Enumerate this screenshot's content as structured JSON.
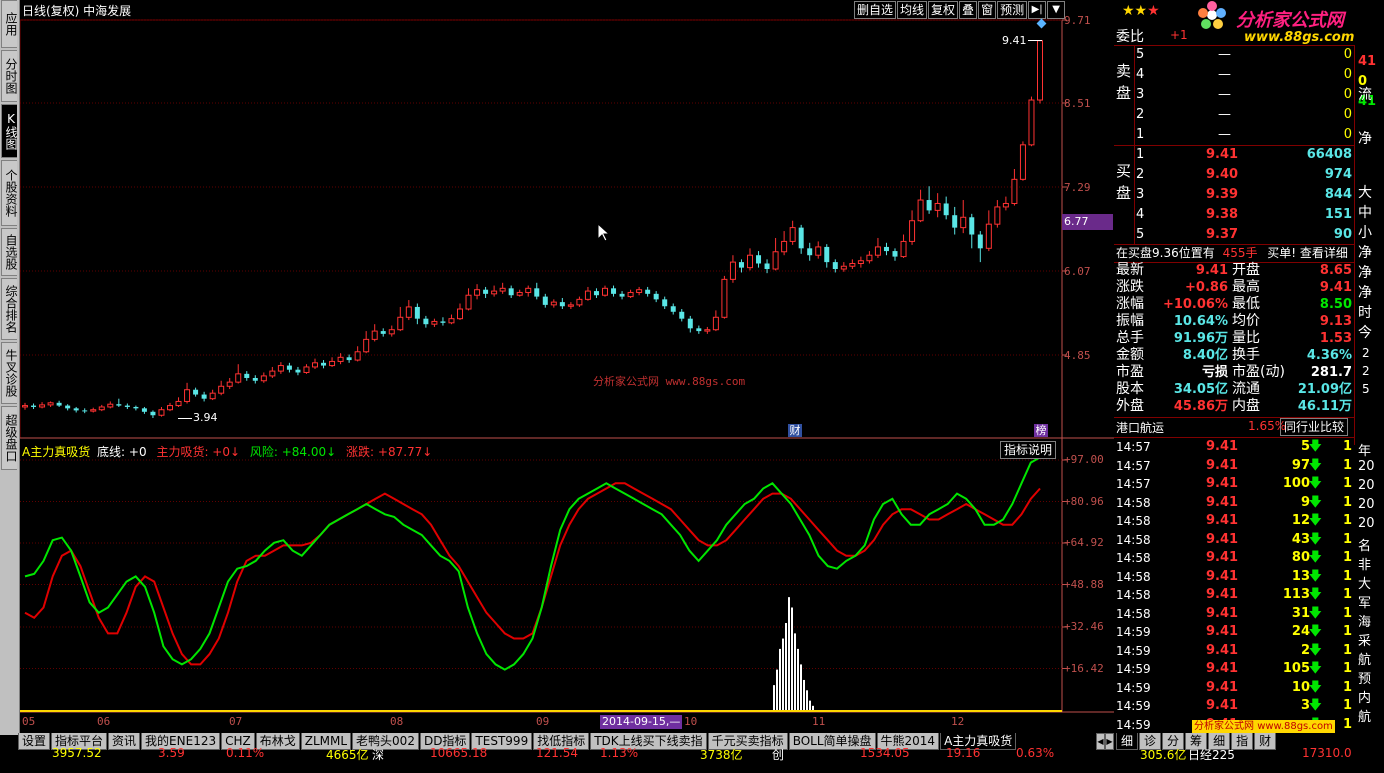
{
  "window": {
    "title": "日线(复权) 中海发展",
    "brand_site": "分析家公式网",
    "brand_url": "www.88gs.com",
    "rating_stars": 3,
    "watermark": "分析家公式网 www.88gs.com"
  },
  "left_tabs": [
    "应用",
    "分时图",
    "K线图",
    "个股资料",
    "自选股",
    "综合排名",
    "牛叉诊股",
    "超级盘口"
  ],
  "left_tab_active": 2,
  "toolbar": [
    "删自选",
    "均线",
    "复权",
    "叠",
    "窗",
    "预测"
  ],
  "price_axis": [
    "9.71",
    "8.51",
    "7.29",
    "6.07",
    "4.85"
  ],
  "price_axis_marker": "6.77",
  "price_labels": {
    "high": "9.41",
    "low": "3.94"
  },
  "markers": {
    "cai": "财",
    "bang": "榜"
  },
  "indicator": {
    "name": "A主力真吸货",
    "line_base": "底线: +0",
    "line_main": "主力吸货: +0↓",
    "line_risk": "风险: +84.00↓",
    "line_rise": "涨跌: +87.77↓",
    "help_button": "指标说明",
    "axis": [
      "+97.00",
      "+80.96",
      "+64.92",
      "+48.88",
      "+32.46",
      "+16.42"
    ]
  },
  "x_axis": {
    "months": [
      "05",
      "06",
      "07",
      "08",
      "09",
      "10",
      "11",
      "12"
    ],
    "cursor_date": "2014-09-15,—"
  },
  "bottom_tabs": [
    "设置",
    "指标平台",
    "资讯",
    "我的ENE123",
    "CHZ",
    "布林戈",
    "ZLMML",
    "老鸭头002",
    "DD指标",
    "TEST999",
    "找低指标",
    "TDK上线买下线卖指",
    "千元买卖指标",
    "BOLL简单操盘",
    "牛熊2014",
    "A主力真吸货"
  ],
  "bottom_tab_active": 15,
  "right_bottom_tabs": [
    "细",
    "诊",
    "分",
    "筹",
    "细",
    "指",
    "财"
  ],
  "order_book": {
    "weibi_label": "委比",
    "weibi_value": "+1",
    "sell_label": "卖盘",
    "buy_label": "买盘",
    "sell": [
      {
        "level": "5",
        "price": "—",
        "vol": "0"
      },
      {
        "level": "4",
        "price": "—",
        "vol": "0"
      },
      {
        "level": "3",
        "price": "—",
        "vol": "0"
      },
      {
        "level": "2",
        "price": "—",
        "vol": "0"
      },
      {
        "level": "1",
        "price": "—",
        "vol": "0"
      }
    ],
    "buy": [
      {
        "level": "1",
        "price": "9.41",
        "vol": "66408"
      },
      {
        "level": "2",
        "price": "9.40",
        "vol": "974"
      },
      {
        "level": "3",
        "price": "9.39",
        "vol": "844"
      },
      {
        "level": "4",
        "price": "9.38",
        "vol": "151"
      },
      {
        "level": "5",
        "price": "9.37",
        "vol": "90"
      }
    ],
    "side_col": [
      "41",
      "0",
      "41"
    ],
    "side_labels": [
      "流",
      "净"
    ],
    "notice": "在买盘9.36位置有",
    "notice_vol": "455手",
    "notice_link": "买单! 查看详细"
  },
  "quote": {
    "rows": [
      {
        "l1": "最新",
        "v1": "9.41",
        "l2": "开盘",
        "v2": "8.65"
      },
      {
        "l1": "涨跌",
        "v1": "+0.86",
        "l2": "最高",
        "v2": "9.41"
      },
      {
        "l1": "涨幅",
        "v1": "+10.06%",
        "l2": "最低",
        "v2": "8.50"
      },
      {
        "l1": "振幅",
        "v1": "10.64%",
        "l2": "均价",
        "v2": "9.13"
      },
      {
        "l1": "总手",
        "v1": "91.96万",
        "l2": "量比",
        "v2": "1.53"
      },
      {
        "l1": "金额",
        "v1": "8.40亿",
        "l2": "换手",
        "v2": "4.36%"
      },
      {
        "l1": "市盈",
        "v1": "亏损",
        "l2": "市盈(动)",
        "v2": "281.7"
      },
      {
        "l1": "股本",
        "v1": "34.05亿",
        "l2": "流通",
        "v2": "21.09亿"
      },
      {
        "l1": "外盘",
        "v1": "45.86万",
        "l2": "内盘",
        "v2": "46.11万"
      }
    ],
    "side_labels": [
      "大",
      "中",
      "小",
      "净",
      "净",
      "净",
      "时",
      "今"
    ],
    "side_numbers": [
      "2",
      "2",
      "5"
    ],
    "industry": "港口航运",
    "industry_pct": "1.65%",
    "compare_button": "同行业比较"
  },
  "ticks": [
    {
      "t": "14:57",
      "p": "9.41",
      "v": "5"
    },
    {
      "t": "14:57",
      "p": "9.41",
      "v": "97"
    },
    {
      "t": "14:57",
      "p": "9.41",
      "v": "100"
    },
    {
      "t": "14:58",
      "p": "9.41",
      "v": "9"
    },
    {
      "t": "14:58",
      "p": "9.41",
      "v": "12"
    },
    {
      "t": "14:58",
      "p": "9.41",
      "v": "43"
    },
    {
      "t": "14:58",
      "p": "9.41",
      "v": "80"
    },
    {
      "t": "14:58",
      "p": "9.41",
      "v": "13"
    },
    {
      "t": "14:58",
      "p": "9.41",
      "v": "113"
    },
    {
      "t": "14:58",
      "p": "9.41",
      "v": "31"
    },
    {
      "t": "14:59",
      "p": "9.41",
      "v": "24"
    },
    {
      "t": "14:59",
      "p": "9.41",
      "v": "2"
    },
    {
      "t": "14:59",
      "p": "9.41",
      "v": "105"
    },
    {
      "t": "14:59",
      "p": "9.41",
      "v": "10"
    },
    {
      "t": "14:59",
      "p": "9.41",
      "v": "3"
    },
    {
      "t": "14:59",
      "p": "9.41",
      "v": "—"
    }
  ],
  "tick_side": [
    "年",
    "20",
    "20",
    "20",
    "20",
    "名",
    "非",
    "大",
    "军",
    "海",
    "采",
    "航",
    "预",
    "内",
    "航"
  ],
  "status_bar": [
    "3957.52",
    "3.59",
    "0.11%",
    "4665亿",
    "深",
    "10665.18",
    "121.54",
    "1.13%",
    "3738亿",
    "创",
    "1534.05",
    "19.16",
    "0.63%",
    "305.6亿",
    "日经225",
    "17310.0"
  ],
  "colors": {
    "up": "#ff3232",
    "down": "#5ae6e6",
    "green": "#00e600",
    "axis": "#c0504d",
    "grid": "#800000"
  },
  "chart_data": {
    "type": "candlestick_with_indicator",
    "price_range": [
      3.94,
      9.71
    ],
    "candles": [
      {
        "o": 4.1,
        "c": 4.12,
        "h": 4.16,
        "l": 4.06
      },
      {
        "o": 4.12,
        "c": 4.1,
        "h": 4.15,
        "l": 4.07
      },
      {
        "o": 4.1,
        "c": 4.13,
        "h": 4.17,
        "l": 4.08
      },
      {
        "o": 4.13,
        "c": 4.16,
        "h": 4.18,
        "l": 4.1
      },
      {
        "o": 4.16,
        "c": 4.12,
        "h": 4.19,
        "l": 4.1
      },
      {
        "o": 4.12,
        "c": 4.08,
        "h": 4.14,
        "l": 4.05
      },
      {
        "o": 4.08,
        "c": 4.05,
        "h": 4.1,
        "l": 4.02
      },
      {
        "o": 4.05,
        "c": 4.04,
        "h": 4.08,
        "l": 4.01
      },
      {
        "o": 4.04,
        "c": 4.06,
        "h": 4.09,
        "l": 4.02
      },
      {
        "o": 4.06,
        "c": 4.1,
        "h": 4.13,
        "l": 4.04
      },
      {
        "o": 4.1,
        "c": 4.14,
        "h": 4.18,
        "l": 4.08
      },
      {
        "o": 4.14,
        "c": 4.12,
        "h": 4.22,
        "l": 4.1
      },
      {
        "o": 4.12,
        "c": 4.1,
        "h": 4.15,
        "l": 4.07
      },
      {
        "o": 4.1,
        "c": 4.08,
        "h": 4.12,
        "l": 4.05
      },
      {
        "o": 4.08,
        "c": 4.03,
        "h": 4.1,
        "l": 4.0
      },
      {
        "o": 4.03,
        "c": 3.98,
        "h": 4.05,
        "l": 3.94
      },
      {
        "o": 3.98,
        "c": 4.06,
        "h": 4.1,
        "l": 3.96
      },
      {
        "o": 4.06,
        "c": 4.12,
        "h": 4.16,
        "l": 4.04
      },
      {
        "o": 4.12,
        "c": 4.18,
        "h": 4.24,
        "l": 4.1
      },
      {
        "o": 4.18,
        "c": 4.35,
        "h": 4.45,
        "l": 4.15
      },
      {
        "o": 4.35,
        "c": 4.28,
        "h": 4.38,
        "l": 4.25
      },
      {
        "o": 4.28,
        "c": 4.22,
        "h": 4.32,
        "l": 4.18
      },
      {
        "o": 4.22,
        "c": 4.3,
        "h": 4.35,
        "l": 4.2
      },
      {
        "o": 4.3,
        "c": 4.4,
        "h": 4.48,
        "l": 4.27
      },
      {
        "o": 4.4,
        "c": 4.46,
        "h": 4.52,
        "l": 4.36
      },
      {
        "o": 4.46,
        "c": 4.58,
        "h": 4.72,
        "l": 4.44
      },
      {
        "o": 4.58,
        "c": 4.52,
        "h": 4.62,
        "l": 4.48
      },
      {
        "o": 4.52,
        "c": 4.48,
        "h": 4.56,
        "l": 4.44
      },
      {
        "o": 4.48,
        "c": 4.55,
        "h": 4.6,
        "l": 4.45
      },
      {
        "o": 4.55,
        "c": 4.62,
        "h": 4.68,
        "l": 4.52
      },
      {
        "o": 4.62,
        "c": 4.7,
        "h": 4.75,
        "l": 4.58
      },
      {
        "o": 4.7,
        "c": 4.64,
        "h": 4.74,
        "l": 4.6
      },
      {
        "o": 4.64,
        "c": 4.6,
        "h": 4.68,
        "l": 4.56
      },
      {
        "o": 4.6,
        "c": 4.68,
        "h": 4.72,
        "l": 4.58
      },
      {
        "o": 4.68,
        "c": 4.74,
        "h": 4.8,
        "l": 4.65
      },
      {
        "o": 4.74,
        "c": 4.7,
        "h": 4.78,
        "l": 4.66
      },
      {
        "o": 4.7,
        "c": 4.76,
        "h": 4.82,
        "l": 4.68
      },
      {
        "o": 4.76,
        "c": 4.82,
        "h": 4.88,
        "l": 4.72
      },
      {
        "o": 4.82,
        "c": 4.78,
        "h": 4.86,
        "l": 4.74
      },
      {
        "o": 4.78,
        "c": 4.9,
        "h": 4.98,
        "l": 4.76
      },
      {
        "o": 4.9,
        "c": 5.08,
        "h": 5.2,
        "l": 4.88
      },
      {
        "o": 5.08,
        "c": 5.2,
        "h": 5.3,
        "l": 5.05
      },
      {
        "o": 5.2,
        "c": 5.16,
        "h": 5.24,
        "l": 5.12
      },
      {
        "o": 5.16,
        "c": 5.22,
        "h": 5.28,
        "l": 5.12
      },
      {
        "o": 5.22,
        "c": 5.4,
        "h": 5.55,
        "l": 5.2
      },
      {
        "o": 5.4,
        "c": 5.55,
        "h": 5.65,
        "l": 5.36
      },
      {
        "o": 5.55,
        "c": 5.38,
        "h": 5.6,
        "l": 5.3
      },
      {
        "o": 5.38,
        "c": 5.3,
        "h": 5.42,
        "l": 5.25
      },
      {
        "o": 5.3,
        "c": 5.34,
        "h": 5.38,
        "l": 5.26
      },
      {
        "o": 5.34,
        "c": 5.32,
        "h": 5.4,
        "l": 5.28
      },
      {
        "o": 5.32,
        "c": 5.38,
        "h": 5.44,
        "l": 5.3
      },
      {
        "o": 5.38,
        "c": 5.52,
        "h": 5.6,
        "l": 5.36
      },
      {
        "o": 5.52,
        "c": 5.72,
        "h": 5.82,
        "l": 5.5
      },
      {
        "o": 5.72,
        "c": 5.8,
        "h": 5.88,
        "l": 5.66
      },
      {
        "o": 5.8,
        "c": 5.74,
        "h": 5.84,
        "l": 5.68
      },
      {
        "o": 5.74,
        "c": 5.78,
        "h": 5.86,
        "l": 5.7
      },
      {
        "o": 5.78,
        "c": 5.82,
        "h": 5.9,
        "l": 5.74
      },
      {
        "o": 5.82,
        "c": 5.72,
        "h": 5.86,
        "l": 5.68
      },
      {
        "o": 5.72,
        "c": 5.76,
        "h": 5.8,
        "l": 5.7
      },
      {
        "o": 5.76,
        "c": 5.82,
        "h": 5.86,
        "l": 5.7
      },
      {
        "o": 5.82,
        "c": 5.7,
        "h": 5.9,
        "l": 5.66
      },
      {
        "o": 5.7,
        "c": 5.58,
        "h": 5.74,
        "l": 5.54
      },
      {
        "o": 5.58,
        "c": 5.62,
        "h": 5.66,
        "l": 5.54
      },
      {
        "o": 5.62,
        "c": 5.56,
        "h": 5.68,
        "l": 5.52
      },
      {
        "o": 5.56,
        "c": 5.58,
        "h": 5.62,
        "l": 5.52
      },
      {
        "o": 5.58,
        "c": 5.66,
        "h": 5.7,
        "l": 5.55
      },
      {
        "o": 5.66,
        "c": 5.78,
        "h": 5.84,
        "l": 5.64
      },
      {
        "o": 5.78,
        "c": 5.72,
        "h": 5.82,
        "l": 5.68
      },
      {
        "o": 5.72,
        "c": 5.82,
        "h": 5.86,
        "l": 5.7
      },
      {
        "o": 5.82,
        "c": 5.74,
        "h": 5.86,
        "l": 5.7
      },
      {
        "o": 5.74,
        "c": 5.7,
        "h": 5.78,
        "l": 5.66
      },
      {
        "o": 5.7,
        "c": 5.76,
        "h": 5.8,
        "l": 5.68
      },
      {
        "o": 5.76,
        "c": 5.8,
        "h": 5.84,
        "l": 5.72
      },
      {
        "o": 5.8,
        "c": 5.74,
        "h": 5.84,
        "l": 5.7
      },
      {
        "o": 5.74,
        "c": 5.66,
        "h": 5.78,
        "l": 5.62
      },
      {
        "o": 5.66,
        "c": 5.56,
        "h": 5.7,
        "l": 5.52
      },
      {
        "o": 5.56,
        "c": 5.48,
        "h": 5.6,
        "l": 5.44
      },
      {
        "o": 5.48,
        "c": 5.38,
        "h": 5.52,
        "l": 5.34
      },
      {
        "o": 5.38,
        "c": 5.24,
        "h": 5.42,
        "l": 5.18
      },
      {
        "o": 5.24,
        "c": 5.2,
        "h": 5.28,
        "l": 5.16
      },
      {
        "o": 5.2,
        "c": 5.22,
        "h": 5.26,
        "l": 5.16
      },
      {
        "o": 5.22,
        "c": 5.4,
        "h": 5.5,
        "l": 5.2
      },
      {
        "o": 5.4,
        "c": 5.95,
        "h": 6.0,
        "l": 5.38
      },
      {
        "o": 5.95,
        "c": 6.2,
        "h": 6.3,
        "l": 5.9
      },
      {
        "o": 6.2,
        "c": 6.12,
        "h": 6.24,
        "l": 6.05
      },
      {
        "o": 6.12,
        "c": 6.3,
        "h": 6.4,
        "l": 6.08
      },
      {
        "o": 6.3,
        "c": 6.18,
        "h": 6.36,
        "l": 6.12
      },
      {
        "o": 6.18,
        "c": 6.1,
        "h": 6.24,
        "l": 6.04
      },
      {
        "o": 6.1,
        "c": 6.35,
        "h": 6.55,
        "l": 6.08
      },
      {
        "o": 6.35,
        "c": 6.5,
        "h": 6.65,
        "l": 6.3
      },
      {
        "o": 6.5,
        "c": 6.7,
        "h": 6.8,
        "l": 6.45
      },
      {
        "o": 6.7,
        "c": 6.4,
        "h": 6.74,
        "l": 6.32
      },
      {
        "o": 6.4,
        "c": 6.3,
        "h": 6.48,
        "l": 6.22
      },
      {
        "o": 6.3,
        "c": 6.42,
        "h": 6.5,
        "l": 6.25
      },
      {
        "o": 6.42,
        "c": 6.2,
        "h": 6.46,
        "l": 6.12
      },
      {
        "o": 6.2,
        "c": 6.1,
        "h": 6.24,
        "l": 6.05
      },
      {
        "o": 6.1,
        "c": 6.14,
        "h": 6.2,
        "l": 6.06
      },
      {
        "o": 6.14,
        "c": 6.18,
        "h": 6.24,
        "l": 6.1
      },
      {
        "o": 6.18,
        "c": 6.22,
        "h": 6.28,
        "l": 6.12
      },
      {
        "o": 6.22,
        "c": 6.3,
        "h": 6.36,
        "l": 6.18
      },
      {
        "o": 6.3,
        "c": 6.42,
        "h": 6.55,
        "l": 6.26
      },
      {
        "o": 6.42,
        "c": 6.36,
        "h": 6.48,
        "l": 6.3
      },
      {
        "o": 6.36,
        "c": 6.28,
        "h": 6.4,
        "l": 6.22
      },
      {
        "o": 6.28,
        "c": 6.5,
        "h": 6.6,
        "l": 6.26
      },
      {
        "o": 6.5,
        "c": 6.8,
        "h": 6.95,
        "l": 6.45
      },
      {
        "o": 6.8,
        "c": 7.1,
        "h": 7.25,
        "l": 6.78
      },
      {
        "o": 7.1,
        "c": 6.95,
        "h": 7.3,
        "l": 6.9
      },
      {
        "o": 6.95,
        "c": 7.05,
        "h": 7.2,
        "l": 6.85
      },
      {
        "o": 7.05,
        "c": 6.88,
        "h": 7.15,
        "l": 6.82
      },
      {
        "o": 6.88,
        "c": 6.7,
        "h": 7.0,
        "l": 6.6
      },
      {
        "o": 6.7,
        "c": 6.85,
        "h": 7.1,
        "l": 6.62
      },
      {
        "o": 6.85,
        "c": 6.6,
        "h": 6.9,
        "l": 6.4
      },
      {
        "o": 6.6,
        "c": 6.4,
        "h": 6.65,
        "l": 6.2
      },
      {
        "o": 6.4,
        "c": 6.75,
        "h": 6.95,
        "l": 6.36
      },
      {
        "o": 6.75,
        "c": 7.0,
        "h": 7.1,
        "l": 6.7
      },
      {
        "o": 7.0,
        "c": 7.05,
        "h": 7.15,
        "l": 6.95
      },
      {
        "o": 7.05,
        "c": 7.4,
        "h": 7.55,
        "l": 7.02
      },
      {
        "o": 7.4,
        "c": 7.9,
        "h": 7.95,
        "l": 7.38
      },
      {
        "o": 7.9,
        "c": 8.55,
        "h": 8.6,
        "l": 7.88
      },
      {
        "o": 8.55,
        "c": 9.41,
        "h": 9.41,
        "l": 8.5
      }
    ],
    "green_line": [
      52,
      53,
      58,
      66,
      67,
      62,
      52,
      42,
      38,
      40,
      45,
      50,
      52,
      48,
      38,
      25,
      20,
      18,
      20,
      24,
      30,
      40,
      50,
      55,
      56,
      58,
      62,
      65,
      66,
      62,
      60,
      64,
      68,
      72,
      74,
      76,
      78,
      80,
      78,
      76,
      75,
      72,
      70,
      68,
      64,
      60,
      58,
      54,
      40,
      30,
      22,
      18,
      16,
      18,
      22,
      28,
      40,
      56,
      70,
      78,
      82,
      84,
      86,
      88,
      86,
      84,
      82,
      80,
      78,
      76,
      72,
      68,
      62,
      58,
      62,
      66,
      72,
      76,
      80,
      82,
      86,
      88,
      84,
      80,
      74,
      68,
      60,
      56,
      55,
      58,
      60,
      64,
      74,
      80,
      82,
      76,
      72,
      72,
      76,
      78,
      80,
      84,
      82,
      78,
      72,
      72,
      74,
      80,
      88,
      96,
      98
    ],
    "red_line": [
      38,
      36,
      40,
      52,
      60,
      62,
      56,
      46,
      36,
      30,
      30,
      38,
      48,
      52,
      50,
      40,
      30,
      22,
      18,
      18,
      22,
      28,
      38,
      50,
      58,
      60,
      60,
      62,
      64,
      64,
      64,
      65,
      68,
      72,
      74,
      76,
      78,
      80,
      82,
      84,
      82,
      80,
      78,
      76,
      72,
      66,
      60,
      56,
      50,
      44,
      38,
      34,
      30,
      28,
      28,
      30,
      40,
      52,
      64,
      72,
      78,
      82,
      84,
      86,
      88,
      88,
      86,
      84,
      82,
      80,
      78,
      74,
      70,
      66,
      64,
      64,
      66,
      70,
      74,
      78,
      82,
      84,
      84,
      82,
      78,
      74,
      70,
      66,
      62,
      60,
      60,
      62,
      66,
      72,
      76,
      78,
      78,
      76,
      74,
      74,
      76,
      78,
      80,
      78,
      76,
      74,
      72,
      72,
      76,
      82,
      86
    ],
    "histogram": [
      0,
      0,
      0,
      0,
      0,
      0,
      10,
      16,
      24,
      28,
      34,
      44,
      40,
      30,
      24,
      18,
      12,
      8,
      4,
      2
    ],
    "indicator_range": [
      0,
      97
    ]
  }
}
